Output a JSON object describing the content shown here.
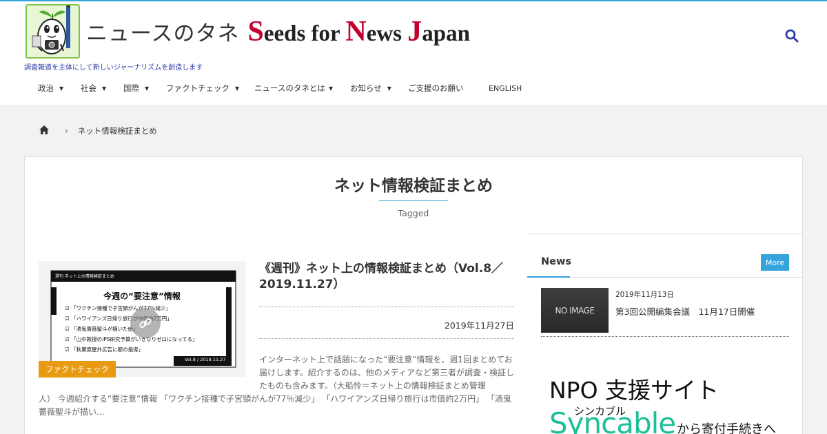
{
  "header": {
    "site_name_jp": "ニュースのタネ",
    "site_name_en": [
      {
        "cap": "S",
        "rest": "eeds for "
      },
      {
        "cap": "N",
        "rest": "ews "
      },
      {
        "cap": "J",
        "rest": "apan"
      }
    ],
    "tagline": "調査報道を主体にして新しいジャーナリズムを創造します",
    "search_icon": "search-icon",
    "accent_color": "#35a3dc",
    "tagline_color": "#2f3dac"
  },
  "nav": [
    {
      "label": "政治",
      "has_dropdown": true
    },
    {
      "label": "社会",
      "has_dropdown": true
    },
    {
      "label": "国際",
      "has_dropdown": true
    },
    {
      "label": "ファクトチェック",
      "has_dropdown": true
    },
    {
      "label": "ニュースのタネとは",
      "has_dropdown": true
    },
    {
      "label": "お知らせ",
      "has_dropdown": true
    },
    {
      "label": "ご支援のお願い",
      "has_dropdown": false
    },
    {
      "label": "ENGLISH",
      "has_dropdown": false
    }
  ],
  "breadcrumb": {
    "home_icon": "home-icon",
    "current": "ネット情報検証まとめ"
  },
  "tag_header": {
    "title": "ネット情報検証まとめ",
    "subtitle": "Tagged"
  },
  "article": {
    "category": "ファクトチェック",
    "category_color": "#e89a12",
    "title": "《週刊》ネット上の情報検証まとめ（Vol.8／2019.11.27）",
    "date": "2019年11月27日",
    "excerpt_part1": "インターネット上で話題になった“要注意”情報を、週1回まとめてお届けします。紹介するのは、他のメディアなど第三者が調査・検証したものも含みます。（大船怜＝ネット上の情報検証まとめ管理",
    "excerpt_part2": "人） 今週紹介する“要注意”情報 「ワクチン接種で子宮頸がんが77％減少」 「ハワイアンズ日帰り旅行は市価約2万円」 「酒鬼薔薇聖斗が描い...",
    "thumbnail": {
      "header": "週刊 ネット上の情報検証まとめ",
      "heading": "今週の“要注意”情報",
      "items": [
        "「ワクチン接種で子宮頸がんが77％減少」",
        "「ハワイアンズ日帰り旅行が市価約2万円」",
        "「酒鬼薔薇聖斗が描いた絵」",
        "「山中教授のiPS研究予算がいきなりゼロになってる」",
        "「秋葉原屋外広告に都の指導」"
      ],
      "footer": "Vol.8 / 2019.11.27",
      "link_icon": "link-icon"
    }
  },
  "sidebar": {
    "news_heading": "News",
    "more_label": "More",
    "news_items": [
      {
        "thumb_text": "NO IMAGE",
        "date": "2019年11月13日",
        "title": "第3回公開編集会議　11月17日開催"
      }
    ],
    "banner": {
      "line1": "NPO 支援サイト",
      "ruby": "シンカブル",
      "brand": "Syncable",
      "tail": "から寄付手続きへ",
      "brand_color": "#1dbf9a"
    }
  }
}
